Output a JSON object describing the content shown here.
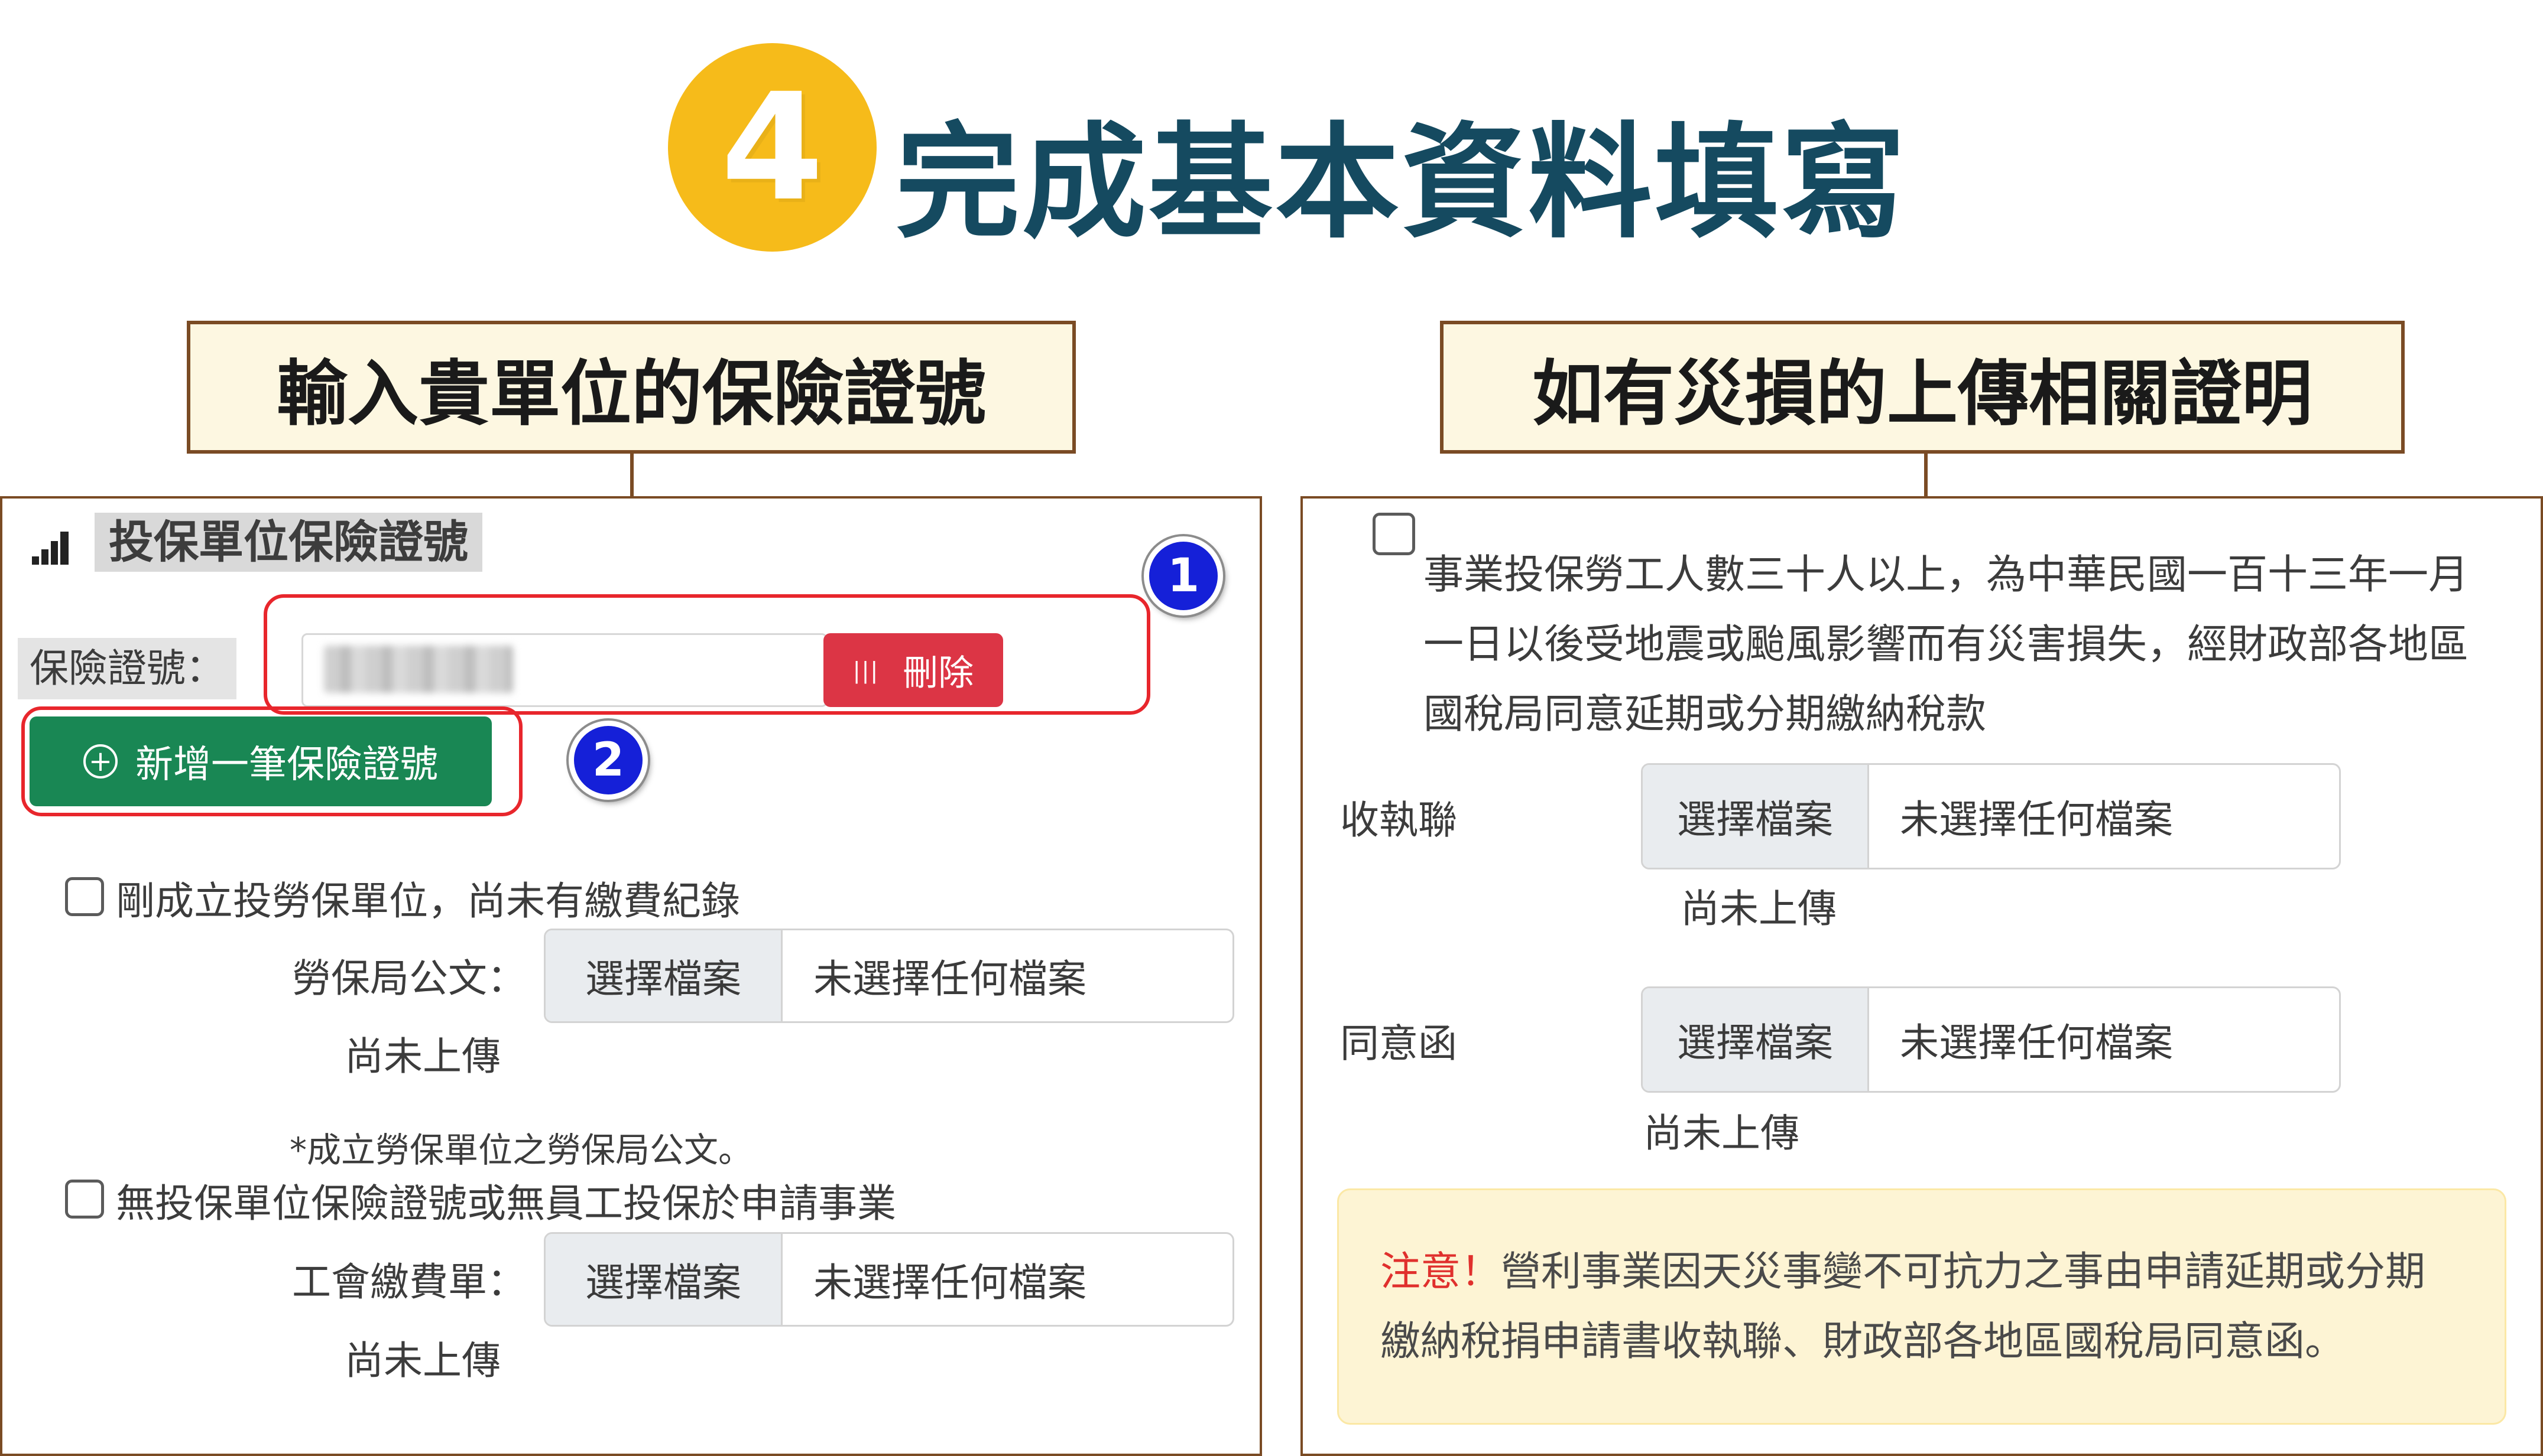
{
  "step": {
    "number": "4",
    "title": "完成基本資料填寫"
  },
  "captions": {
    "left": "輸入貴單位的保險證號",
    "right": "如有災損的上傳相關證明"
  },
  "left_panel": {
    "heading": "投保單位保險證號",
    "insurance_label": "保險證號：",
    "delete_button": "刪除",
    "add_button": "新增一筆保險證號",
    "markers": [
      "1",
      "2"
    ],
    "new_unit_checkbox_label": "剛成立投勞保單位，尚未有繳費紀錄",
    "labor_doc": {
      "label": "勞保局公文：",
      "choose_button": "選擇檔案",
      "file_status": "未選擇任何檔案",
      "upload_status": "尚未上傳"
    },
    "note": "*成立勞保單位之勞保局公文。",
    "no_number_checkbox_label": "無投保單位保險證號或無員工投保於申請事業",
    "union_bill": {
      "label": "工會繳費單：",
      "choose_button": "選擇檔案",
      "file_status": "未選擇任何檔案",
      "upload_status": "尚未上傳"
    }
  },
  "right_panel": {
    "disaster_checkbox_lines": [
      "事業投保勞工人數三十人以上，為中華民國一百十三年一月",
      "一日以後受地震或颱風影響而有災害損失，經財政部各地區",
      "國稅局同意延期或分期繳納稅款"
    ],
    "receipt": {
      "label": "收執聯",
      "choose_button": "選擇檔案",
      "file_status": "未選擇任何檔案",
      "upload_status": "尚未上傳"
    },
    "consent": {
      "label": "同意函",
      "choose_button": "選擇檔案",
      "file_status": "未選擇任何檔案",
      "upload_status": "尚未上傳"
    },
    "notice": {
      "prefix": "注意！",
      "line1": "營利事業因天災事變不可抗力之事由申請延期或分期",
      "line2": "繳納稅捐申請書收執聯、財政部各地區國稅局同意函。"
    }
  },
  "colors": {
    "step_badge": "#f6bb1a",
    "title": "#154a60",
    "caption_border": "#7a4b24",
    "caption_bg": "#fdf7e1",
    "danger": "#dc3545",
    "success": "#198754",
    "marker": "#1520d8",
    "outline": "#e8262c",
    "notice_bg": "#fdf4d4",
    "notice_strong": "#e0302d"
  },
  "icons": {
    "panel": "bar-chart-icon",
    "delete": "trash-icon",
    "add": "plus-circle-icon"
  }
}
